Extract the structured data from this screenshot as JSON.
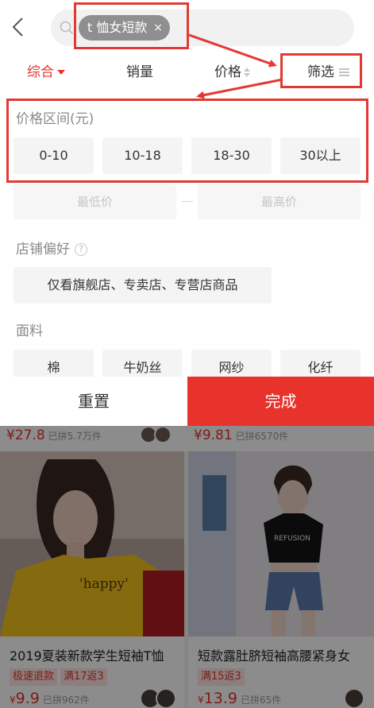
{
  "header": {
    "search_query": "t 恤女短款",
    "clear_symbol": "×"
  },
  "sort_bar": {
    "comprehensive": "综合",
    "sales": "销量",
    "price": "价格",
    "filter": "筛选"
  },
  "filter_panel": {
    "price_range_title": "价格区间(元)",
    "price_options": [
      "0-10",
      "10-18",
      "18-30",
      "30以上"
    ],
    "min_price_placeholder": "最低价",
    "max_price_placeholder": "最高价",
    "store_pref_title": "店铺偏好",
    "store_pref_help": "?",
    "store_option": "仅看旗舰店、专卖店、专营店商品",
    "fabric_title": "面料",
    "fabric_options": [
      "棉",
      "牛奶丝",
      "网纱",
      "化纤"
    ]
  },
  "footer": {
    "reset_label": "重置",
    "done_label": "完成"
  },
  "products": {
    "prev_row": [
      {
        "price": "¥27.8",
        "sold": "已拼5.7万件"
      },
      {
        "price": "¥9.81",
        "sold": "已拼6570件"
      }
    ],
    "cards": [
      {
        "title": "2019夏装新款学生短袖T恤",
        "badges": [
          "极速退款",
          "满17返3"
        ],
        "price_symbol": "¥",
        "price": "9.9",
        "sold": "已拼962件",
        "shirt_text": "'happy'"
      },
      {
        "title": "短款露肚脐短袖高腰紧身女",
        "badges": [
          "满15返3"
        ],
        "price_symbol": "¥",
        "price": "13.9",
        "sold": "已拼65件",
        "shirt_text": "REFUSION"
      }
    ]
  },
  "colors": {
    "accent_red": "#e8332c",
    "annotation_red": "#e23a33",
    "chip_gray": "#8f8f8f"
  }
}
